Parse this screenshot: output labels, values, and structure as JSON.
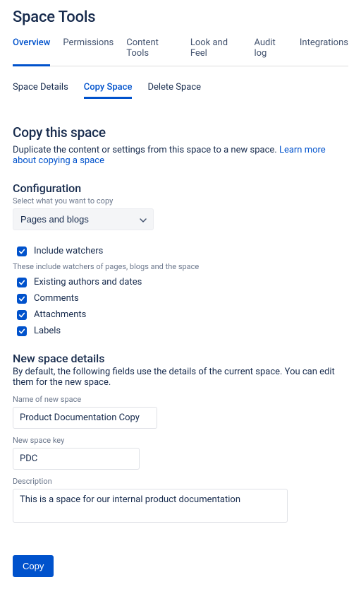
{
  "header": {
    "title": "Space Tools"
  },
  "tabs": {
    "items": [
      "Overview",
      "Permissions",
      "Content Tools",
      "Look and Feel",
      "Audit log",
      "Integrations"
    ],
    "activeIndex": 0
  },
  "subtabs": {
    "items": [
      "Space Details",
      "Copy Space",
      "Delete Space"
    ],
    "activeIndex": 1
  },
  "copy": {
    "title": "Copy this space",
    "desc_prefix": "Duplicate the content or settings from this space to a new space. ",
    "learn_more": "Learn more about copying a space"
  },
  "config": {
    "heading": "Configuration",
    "select_helper": "Select what you want to copy",
    "select_value": "Pages and blogs",
    "include_watchers_label": "Include watchers",
    "watchers_helper": "These include watchers of pages, blogs and the space",
    "options": [
      "Existing authors and dates",
      "Comments",
      "Attachments",
      "Labels"
    ]
  },
  "newspace": {
    "heading": "New space details",
    "desc": "By default, the following fields use the details of the current space. You can edit them for the new space.",
    "name_label": "Name of new space",
    "name_value": "Product Documentation Copy",
    "key_label": "New space key",
    "key_value": "PDC",
    "desc_label": "Description",
    "desc_value": "This is a space for our internal product documentation"
  },
  "actions": {
    "copy_button": "Copy"
  }
}
